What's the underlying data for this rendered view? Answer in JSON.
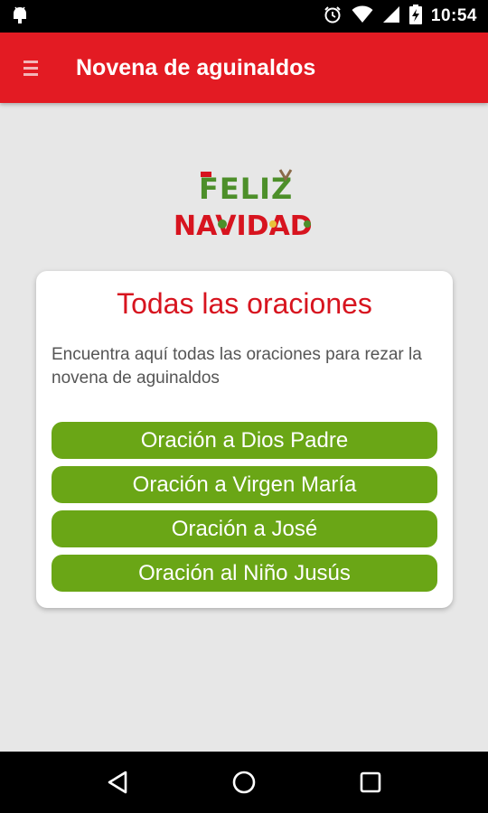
{
  "status_bar": {
    "time": "10:54",
    "icons": [
      "android-debug-icon",
      "alarm-icon",
      "wifi-icon",
      "signal-icon",
      "battery-charging-icon"
    ]
  },
  "app_bar": {
    "title": "Novena de aguinaldos",
    "menu_icon": "hamburger-menu-icon"
  },
  "logo": {
    "line1": "FELIZ",
    "line2": "NAVIDAD"
  },
  "card": {
    "title": "Todas las oraciones",
    "description": "Encuentra aquí todas las oraciones para rezar la novena de aguinaldos",
    "buttons": [
      {
        "label": "Oración a Dios Padre"
      },
      {
        "label": "Oración a Virgen María"
      },
      {
        "label": "Oración a José"
      },
      {
        "label": "Oración al Niño Jusús"
      }
    ]
  },
  "colors": {
    "app_bar": "#e31b23",
    "title_red": "#d7141f",
    "button_green": "#6aa616",
    "background": "#e7e7e7"
  },
  "nav_bar": {
    "icons": [
      "back-icon",
      "home-icon",
      "recents-icon"
    ]
  }
}
